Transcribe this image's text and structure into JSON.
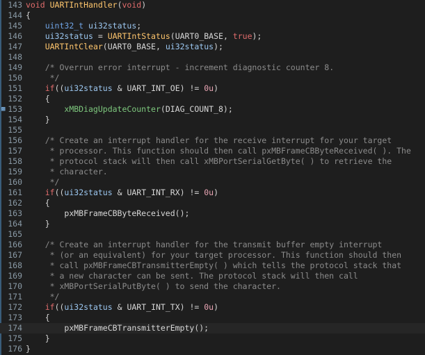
{
  "editor": {
    "lines": [
      {
        "no": "143",
        "segs": [
          [
            "kw",
            "void "
          ],
          [
            "fn",
            "UARTIntHandler"
          ],
          [
            "op",
            "("
          ],
          [
            "kw",
            "void"
          ],
          [
            "op",
            ")"
          ]
        ]
      },
      {
        "no": "144",
        "segs": [
          [
            "op",
            "{"
          ]
        ]
      },
      {
        "no": "145",
        "segs": [
          [
            "op",
            "    "
          ],
          [
            "ty",
            "uint32_t"
          ],
          [
            "op",
            " "
          ],
          [
            "vr",
            "ui32status"
          ],
          [
            "op",
            ";"
          ]
        ]
      },
      {
        "no": "146",
        "segs": [
          [
            "op",
            "    "
          ],
          [
            "vr",
            "ui32status"
          ],
          [
            "op",
            " = "
          ],
          [
            "fn",
            "UARTIntStatus"
          ],
          [
            "op",
            "("
          ],
          [
            "mc",
            "UART0_BASE"
          ],
          [
            "op",
            ", "
          ],
          [
            "kw",
            "true"
          ],
          [
            "op",
            ");"
          ]
        ]
      },
      {
        "no": "147",
        "segs": [
          [
            "op",
            "    "
          ],
          [
            "fn",
            "UARTIntClear"
          ],
          [
            "op",
            "("
          ],
          [
            "mc",
            "UART0_BASE"
          ],
          [
            "op",
            ", "
          ],
          [
            "vr",
            "ui32status"
          ],
          [
            "op",
            ");"
          ]
        ]
      },
      {
        "no": "148",
        "segs": []
      },
      {
        "no": "149",
        "segs": [
          [
            "op",
            "    "
          ],
          [
            "cm",
            "/* Overrun error interrupt - increment diagnostic counter 8."
          ]
        ]
      },
      {
        "no": "150",
        "segs": [
          [
            "cm",
            "     */"
          ]
        ]
      },
      {
        "no": "151",
        "segs": [
          [
            "op",
            "    "
          ],
          [
            "kw",
            "if"
          ],
          [
            "op",
            "(("
          ],
          [
            "vr",
            "ui32status"
          ],
          [
            "op",
            " & "
          ],
          [
            "mc",
            "UART_INT_OE"
          ],
          [
            "op",
            ") != "
          ],
          [
            "nm",
            "0u"
          ],
          [
            "op",
            ")"
          ]
        ]
      },
      {
        "no": "152",
        "segs": [
          [
            "op",
            "    {"
          ]
        ]
      },
      {
        "no": "153",
        "segs": [
          [
            "op",
            "        "
          ],
          [
            "gr",
            "xMBDiagUpdateCounter"
          ],
          [
            "op",
            "("
          ],
          [
            "mc",
            "DIAG_COUNT_8"
          ],
          [
            "op",
            ");"
          ]
        ],
        "mark": true
      },
      {
        "no": "154",
        "segs": [
          [
            "op",
            "    }"
          ]
        ]
      },
      {
        "no": "155",
        "segs": []
      },
      {
        "no": "156",
        "segs": [
          [
            "op",
            "    "
          ],
          [
            "cm",
            "/* Create an interrupt handler for the receive interrupt for your target"
          ]
        ]
      },
      {
        "no": "157",
        "segs": [
          [
            "cm",
            "     * processor. This function should then call pxMBFrameCBByteReceived( ). The"
          ]
        ]
      },
      {
        "no": "158",
        "segs": [
          [
            "cm",
            "     * protocol stack will then call xMBPortSerialGetByte( ) to retrieve the"
          ]
        ]
      },
      {
        "no": "159",
        "segs": [
          [
            "cm",
            "     * character."
          ]
        ]
      },
      {
        "no": "160",
        "segs": [
          [
            "cm",
            "     */"
          ]
        ]
      },
      {
        "no": "161",
        "segs": [
          [
            "op",
            "    "
          ],
          [
            "kw",
            "if"
          ],
          [
            "op",
            "(("
          ],
          [
            "vr",
            "ui32status"
          ],
          [
            "op",
            " & "
          ],
          [
            "mc",
            "UART_INT_RX"
          ],
          [
            "op",
            ") != "
          ],
          [
            "nm",
            "0u"
          ],
          [
            "op",
            ")"
          ]
        ]
      },
      {
        "no": "162",
        "segs": [
          [
            "op",
            "    {"
          ]
        ]
      },
      {
        "no": "163",
        "segs": [
          [
            "op",
            "        "
          ],
          [
            "mc",
            "pxMBFrameCBByteReceived"
          ],
          [
            "op",
            "();"
          ]
        ]
      },
      {
        "no": "164",
        "segs": [
          [
            "op",
            "    }"
          ]
        ]
      },
      {
        "no": "165",
        "segs": []
      },
      {
        "no": "166",
        "segs": [
          [
            "op",
            "    "
          ],
          [
            "cm",
            "/* Create an interrupt handler for the transmit buffer empty interrupt"
          ]
        ]
      },
      {
        "no": "167",
        "segs": [
          [
            "cm",
            "     * (or an equivalent) for your target processor. This function should then"
          ]
        ]
      },
      {
        "no": "168",
        "segs": [
          [
            "cm",
            "     * call pxMBFrameCBTransmitterEmpty( ) which tells the protocol stack that"
          ]
        ]
      },
      {
        "no": "169",
        "segs": [
          [
            "cm",
            "     * a new character can be sent. The protocol stack will then call"
          ]
        ]
      },
      {
        "no": "170",
        "segs": [
          [
            "cm",
            "     * xMBPortSerialPutByte( ) to send the character."
          ]
        ]
      },
      {
        "no": "171",
        "segs": [
          [
            "cm",
            "     */"
          ]
        ]
      },
      {
        "no": "172",
        "segs": [
          [
            "op",
            "    "
          ],
          [
            "kw",
            "if"
          ],
          [
            "op",
            "(("
          ],
          [
            "vr",
            "ui32status"
          ],
          [
            "op",
            " & "
          ],
          [
            "mc",
            "UART_INT_TX"
          ],
          [
            "op",
            ") != "
          ],
          [
            "nm",
            "0u"
          ],
          [
            "op",
            ")"
          ]
        ]
      },
      {
        "no": "173",
        "segs": [
          [
            "op",
            "    {"
          ]
        ]
      },
      {
        "no": "174",
        "segs": [
          [
            "op",
            "        "
          ],
          [
            "mc",
            "pxMBFrameCBTransmitterEmpty"
          ],
          [
            "op",
            "();"
          ]
        ],
        "highlight": true
      },
      {
        "no": "175",
        "segs": [
          [
            "op",
            "    }"
          ]
        ]
      },
      {
        "no": "176",
        "segs": [
          [
            "op",
            "}"
          ]
        ]
      }
    ],
    "colors": {
      "background": "#1e1e1e",
      "keyword": "#e06c6c",
      "function": "#ffc66d",
      "type": "#6fa3e4",
      "comment": "#8c8c8c",
      "line_number": "#8a9aa6"
    },
    "icons": {
      "breakpoint_marker": "bookmark-icon"
    }
  }
}
